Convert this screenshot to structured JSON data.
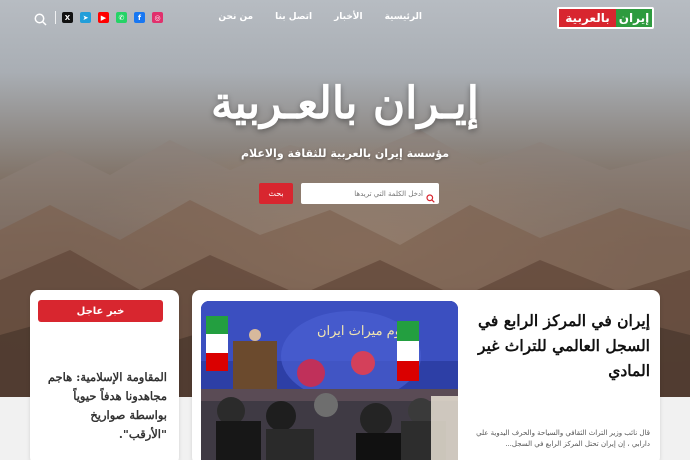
{
  "header": {
    "logo_part1": "إيران",
    "logo_part2": "بالعربية",
    "nav": [
      {
        "label": "الرئيسية"
      },
      {
        "label": "الأخبار"
      },
      {
        "label": "اتصل بنا"
      },
      {
        "label": "من نحن"
      }
    ],
    "social": [
      {
        "icon": "instagram-icon",
        "glyph": "◎",
        "color": "#e1306c"
      },
      {
        "icon": "facebook-icon",
        "glyph": "f",
        "color": "#1877f2"
      },
      {
        "icon": "whatsapp-icon",
        "glyph": "✆",
        "color": "#25d366"
      },
      {
        "icon": "youtube-icon",
        "glyph": "▶",
        "color": "#ff0000"
      },
      {
        "icon": "telegram-icon",
        "glyph": "➤",
        "color": "#229ed9"
      },
      {
        "icon": "x-icon",
        "glyph": "X",
        "color": "#111111"
      }
    ]
  },
  "hero": {
    "title": "إيـران بالعـربية",
    "subtitle": "مؤسسة إيران بالعربية للثقافة والاعلام",
    "search_placeholder": "أدخل الكلمة التي تريدها",
    "search_button": "بحث"
  },
  "breaking": {
    "badge": "خبر عاجل",
    "text": "المقاومة الإسلامية: هاجم مجاهدونا هدفاً حيوياً بواسطة صواريخ \"الأرقب\"."
  },
  "feature": {
    "title": "إيران في المركز الرابع في السجل العالمي للتراث غير المادي",
    "excerpt": "قال نائب وزير التراث الثقافي والسياحة والحرف اليدوية علي دارابي ، إن إيران تحتل المركز الرابع في السجل...",
    "image_alt": "conference-photo"
  },
  "colors": {
    "brand_red": "#d8262f",
    "brand_green": "#2e9b3f"
  }
}
